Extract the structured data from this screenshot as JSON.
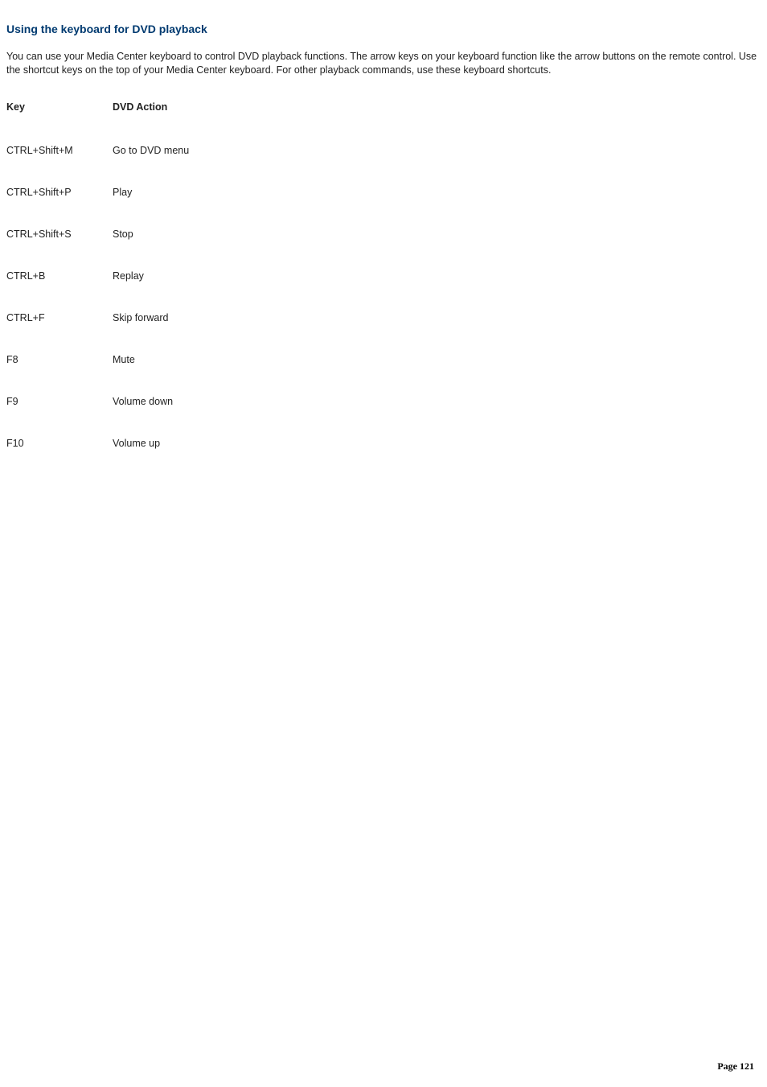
{
  "heading": "Using the keyboard for DVD playback",
  "intro": "You can use your Media Center keyboard to control DVD playback functions. The arrow keys on your keyboard function like the arrow buttons on the remote control. Use the shortcut keys on the top of your Media Center keyboard. For other playback commands, use these keyboard shortcuts.",
  "table": {
    "header": {
      "key": "Key",
      "action": "DVD Action"
    },
    "rows": [
      {
        "key": "CTRL+Shift+M",
        "action": "Go to DVD menu"
      },
      {
        "key": "CTRL+Shift+P",
        "action": "Play"
      },
      {
        "key": "CTRL+Shift+S",
        "action": "Stop"
      },
      {
        "key": "CTRL+B",
        "action": "Replay"
      },
      {
        "key": "CTRL+F",
        "action": "Skip forward"
      },
      {
        "key": "F8",
        "action": "Mute"
      },
      {
        "key": "F9",
        "action": "Volume down"
      },
      {
        "key": "F10",
        "action": "Volume up"
      }
    ]
  },
  "footer": {
    "label": "Page",
    "number": "121"
  }
}
